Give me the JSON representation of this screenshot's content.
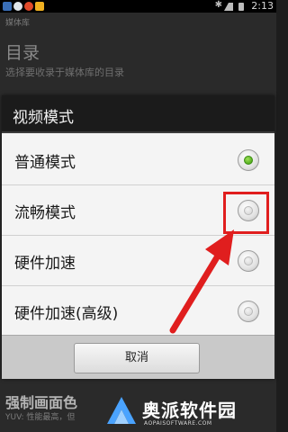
{
  "status_bar": {
    "clock": "2:13",
    "icons": [
      "app-icon",
      "app-icon",
      "app-icon",
      "app-icon",
      "bluetooth-icon",
      "signal-icon",
      "battery-icon"
    ]
  },
  "background": {
    "header_title": "媒体库",
    "heading": "目录",
    "subtitle": "选择要收录于媒体库的目录",
    "bottom_heading": "强制画面色",
    "bottom_subtitle": "YUV: 性能最高，但"
  },
  "dialog": {
    "title": "视频模式",
    "options": [
      {
        "label": "普通模式",
        "checked": true
      },
      {
        "label": "流畅模式",
        "checked": false
      },
      {
        "label": "硬件加速",
        "checked": false
      },
      {
        "label": "硬件加速(高级)",
        "checked": false
      }
    ],
    "cancel_label": "取消"
  },
  "annotations": {
    "highlight_color": "#e01e1e",
    "arrow_color": "#e01e1e"
  },
  "watermark": {
    "text": "奥派软件园",
    "url": "AOPAISOFTWARE.COM"
  },
  "colors": {
    "selected_radio": "#56b01f",
    "dialog_title_bg": "#1b1b1b",
    "dialog_bg": "#f4f4f4"
  }
}
